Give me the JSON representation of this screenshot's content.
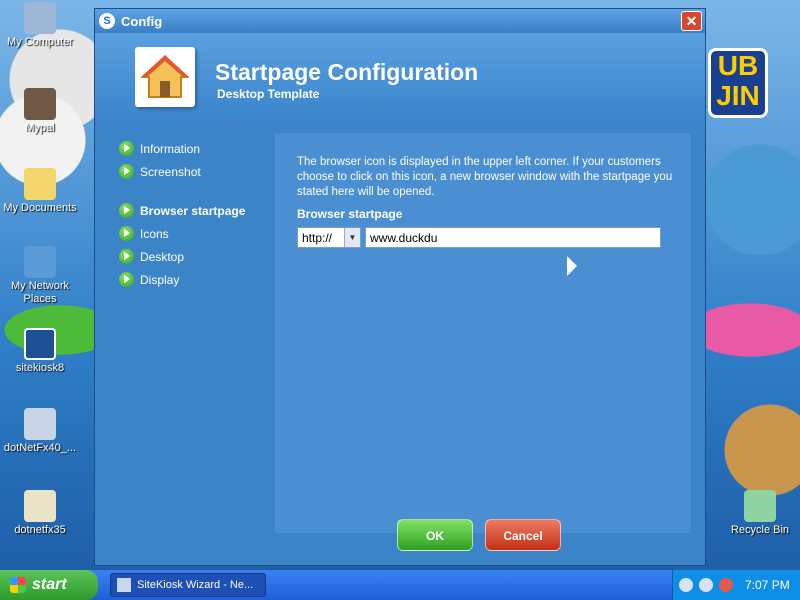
{
  "desktop": {
    "icons": [
      {
        "label": "My Computer"
      },
      {
        "label": "Mypal"
      },
      {
        "label": "My Documents"
      },
      {
        "label": "My Network Places"
      },
      {
        "label": "sitekiosk8"
      },
      {
        "label": "dotNetFx40_..."
      },
      {
        "label": "dotnetfx35"
      },
      {
        "label": "Recycle Bin"
      }
    ],
    "logo_text": "UB JIN"
  },
  "window": {
    "title": "Config",
    "header_title": "Startpage Configuration",
    "header_subtitle": "Desktop Template",
    "nav": [
      {
        "label": "Information"
      },
      {
        "label": "Screenshot"
      },
      {
        "label": "Browser startpage"
      },
      {
        "label": "Icons"
      },
      {
        "label": "Desktop"
      },
      {
        "label": "Display"
      }
    ],
    "description": "The browser icon is displayed in the upper left corner. If your customers choose to click on this icon, a new browser window with the startpage you stated here will be opened.",
    "field_label": "Browser startpage",
    "protocol_value": "http://",
    "url_value": "www.duckdu",
    "ok_label": "OK",
    "cancel_label": "Cancel"
  },
  "taskbar": {
    "start_label": "start",
    "task_label": "SiteKiosk Wizard - Ne...",
    "clock": "7:07 PM"
  },
  "colors": {
    "window_bg": "#3c84c8",
    "ok_green": "#2f9f1e",
    "cancel_red": "#c23015"
  }
}
